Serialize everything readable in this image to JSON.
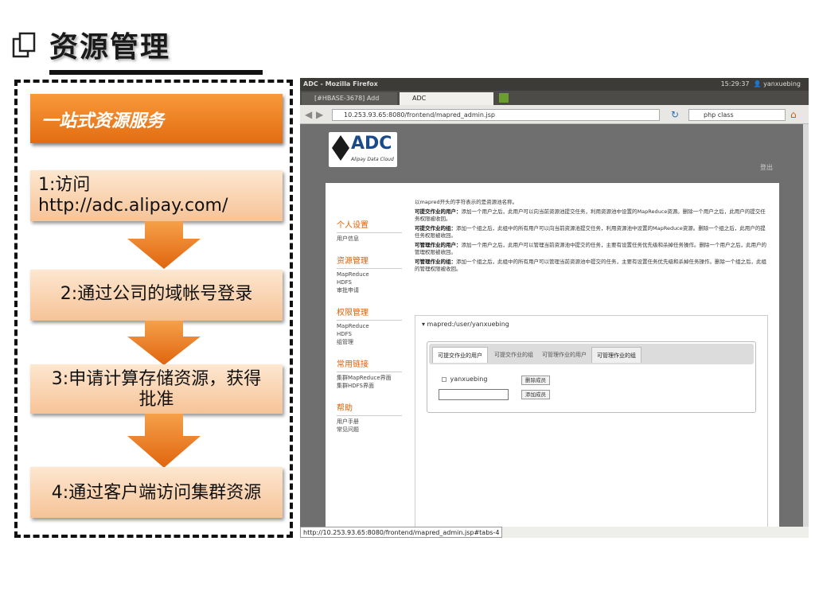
{
  "slide": {
    "title": "资源管理",
    "flow": {
      "header": "一站式资源服务",
      "steps": [
        {
          "line1": "1:访问",
          "line2": "http://adc.alipay.com/"
        },
        {
          "text": "2:通过公司的域帐号登录"
        },
        {
          "line1": "3:申请计算存储资源，获得",
          "line2": "批准"
        },
        {
          "text": "4:通过客户端访问集群资源"
        }
      ]
    },
    "colors": {
      "accent": "#e8781f",
      "step_fill": "#fbd7b5",
      "frame": "#111111"
    }
  },
  "browser": {
    "window_title": "ADC - Mozilla Firefox",
    "clock": "15:29:37",
    "user": "yanxuebing",
    "tabs": [
      "[#HBASE-3678] Add Eclipse...",
      "ADC"
    ],
    "url": "10.253.93.65:8080/frontend/mapred_admin.jsp",
    "search": "php class",
    "status_url": "http://10.253.93.65:8080/frontend/mapred_admin.jsp#tabs-4"
  },
  "app": {
    "logo_text": "ADC",
    "logo_sub": "Alipay Data Cloud",
    "logout": "登出",
    "menu": [
      {
        "head": "个人设置",
        "items": [
          "用户信息"
        ]
      },
      {
        "head": "资源管理",
        "items": [
          "MapReduce",
          "HDFS",
          "审批申请"
        ]
      },
      {
        "head": "权限管理",
        "items": [
          "MapReduce",
          "HDFS",
          "组管理"
        ]
      },
      {
        "head": "常用链接",
        "items": [
          "集群MapReduce界面",
          "集群HDFS界面"
        ]
      },
      {
        "head": "帮助",
        "items": [
          "用户手册",
          "常见问题"
        ]
      }
    ],
    "intro": "以mapred开头的字符表示的是资源池名称。",
    "descriptions": [
      {
        "label": "可提交作业的用户：",
        "text": "添加一个用户之后，此用户可以向当前资源池提交任务，利用资源池中设置的MapReduce资源。删除一个用户之后，此用户的提交任务权限被收回。"
      },
      {
        "label": "可提交作业的组：",
        "text": "添加一个组之后，此组中的所有用户可以向当前资源池提交任务，利用资源池中设置的MapReduce资源。删除一个组之后，此用户的提任务权限被收回。"
      },
      {
        "label": "可管理作业的用户：",
        "text": "添加一个用户之后，此用户可以管理当前资源池中提交的任务，主要有设置任务优先级和杀掉任务操作。删除一个用户之后，此用户的管理权限被收回。"
      },
      {
        "label": "可管理作业的组：",
        "text": "添加一个组之后，此组中的所有用户可以管理当前资源池中提交的任务，主要有设置任务优先级和杀掉任务操作。删除一个组之后，此组的管理权限被收回。"
      }
    ],
    "pool_path": "▾ mapred:/user/yanxuebing",
    "pool_tabs": [
      "可提交作业的用户",
      "可提交作业的组",
      "可管理作业的用户",
      "可管理作业的组"
    ],
    "member": "yanxuebing",
    "remove_label": "删除成员",
    "add_label": "添加成员"
  }
}
